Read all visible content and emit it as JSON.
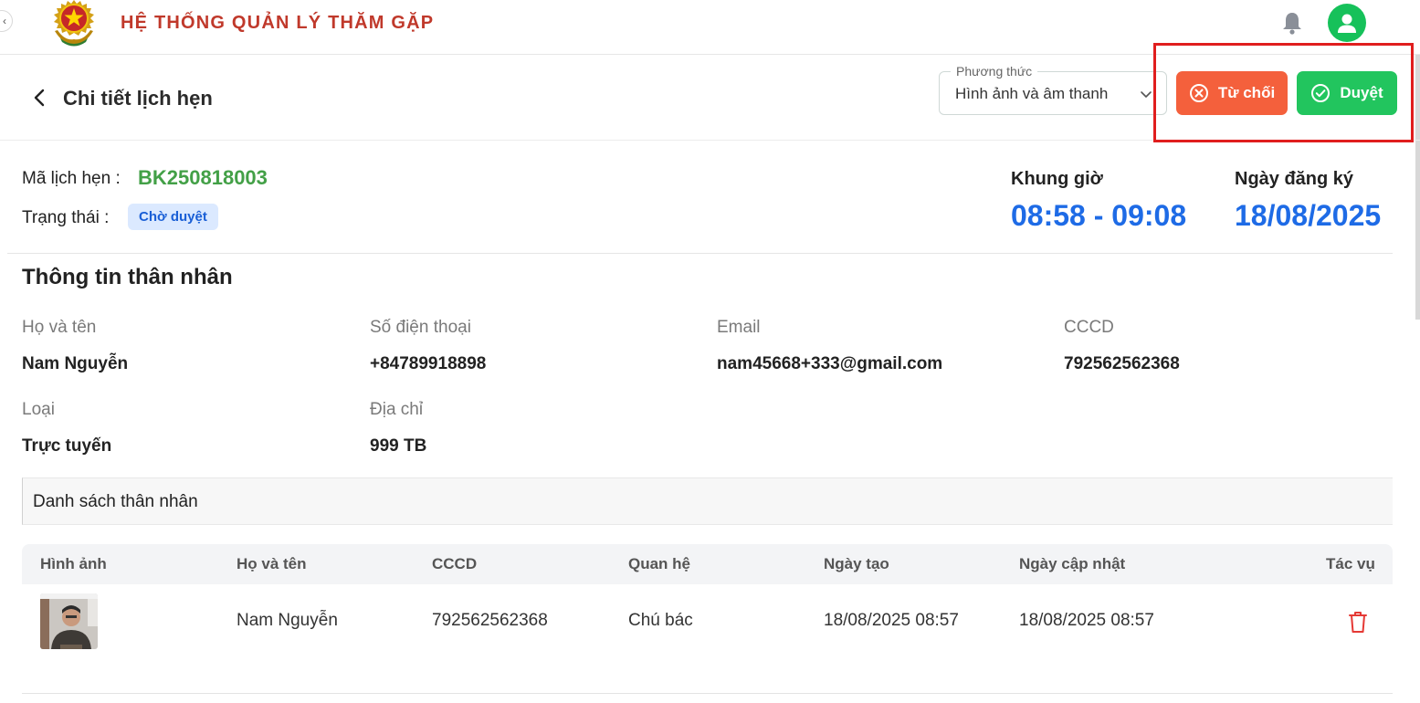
{
  "app": {
    "title": "HỆ THỐNG QUẢN LÝ THĂM GẶP",
    "collapse_icon": "chevron-left-icon",
    "logo": "police-emblem",
    "notification_icon": "bell-icon",
    "user_icon": "user-icon"
  },
  "header": {
    "title": "Chi tiết lịch hẹn",
    "method": {
      "label": "Phương thức",
      "value": "Hình ảnh và âm thanh"
    },
    "reject_label": "Từ chối",
    "approve_label": "Duyệt"
  },
  "appointment": {
    "code_label": "Mã lịch hẹn :",
    "code": "BK250818003",
    "status_label": "Trạng thái :",
    "status": "Chờ duyệt",
    "time_slot_label": "Khung giờ",
    "time_slot": "08:58 - 09:08",
    "date_label": "Ngày đăng ký",
    "date": "18/08/2025"
  },
  "relative_info": {
    "title": "Thông tin thân nhân",
    "fields": {
      "name_label": "Họ và tên",
      "name": "Nam Nguyễn",
      "phone_label": "Số điện thoại",
      "phone": "+84789918898",
      "email_label": "Email",
      "email": "nam45668+333@gmail.com",
      "id_label": "CCCD",
      "id": "792562562368",
      "type_label": "Loại",
      "type": "Trực tuyến",
      "address_label": "Địa chỉ",
      "address": "999 TB"
    }
  },
  "relatives_list": {
    "title": "Danh sách thân nhân",
    "columns": [
      "Hình ảnh",
      "Họ và tên",
      "CCCD",
      "Quan hệ",
      "Ngày tạo",
      "Ngày cập nhật",
      "Tác vụ"
    ],
    "rows": [
      {
        "name": "Nam Nguyễn",
        "id": "792562562368",
        "relation": "Chú bác",
        "created": "18/08/2025 08:57",
        "updated": "18/08/2025 08:57"
      }
    ]
  },
  "colors": {
    "title_red": "#c0392b",
    "code_green": "#43a047",
    "time_blue": "#1e6be6",
    "reject": "#f4603c",
    "approve": "#22c55e",
    "highlight": "#e01e1e"
  }
}
